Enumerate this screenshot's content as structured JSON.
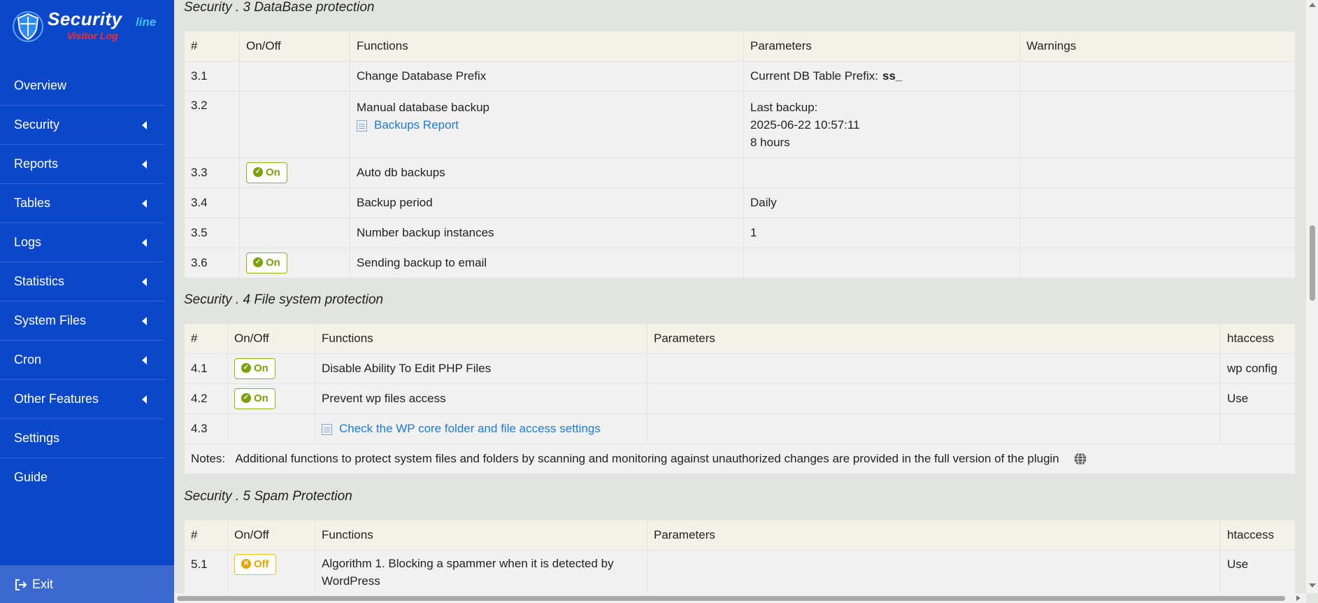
{
  "logo": {
    "title": "Security",
    "title_suffix": "line",
    "subtitle": "Visitor Log"
  },
  "sidebar": {
    "items": [
      {
        "label": "Overview",
        "has_arrow": false
      },
      {
        "label": "Security",
        "has_arrow": true
      },
      {
        "label": "Reports",
        "has_arrow": true
      },
      {
        "label": "Tables",
        "has_arrow": true
      },
      {
        "label": "Logs",
        "has_arrow": true
      },
      {
        "label": "Statistics",
        "has_arrow": true
      },
      {
        "label": "System Files",
        "has_arrow": true
      },
      {
        "label": "Cron",
        "has_arrow": true
      },
      {
        "label": "Other Features",
        "has_arrow": true
      },
      {
        "label": "Settings",
        "has_arrow": false
      },
      {
        "label": "Guide",
        "has_arrow": false
      }
    ],
    "exit_label": "Exit"
  },
  "sections": {
    "s3": {
      "title": "Security .  3  DataBase protection",
      "headers": [
        "#",
        "On/Off",
        "Functions",
        "Parameters",
        "Warnings"
      ],
      "rows": {
        "r1": {
          "num": "3.1",
          "function": "Change Database Prefix",
          "param_label": "Current DB Table Prefix:",
          "param_value": "ss_"
        },
        "r2": {
          "num": "3.2",
          "function": "Manual database backup",
          "link": "Backups Report",
          "param_line1": "Last backup:",
          "param_line2": "2025-06-22 10:57:11",
          "param_line3": "8 hours"
        },
        "r3": {
          "num": "3.3",
          "toggle": "On",
          "function": "Auto db backups"
        },
        "r4": {
          "num": "3.4",
          "function": "Backup period",
          "param": "Daily"
        },
        "r5": {
          "num": "3.5",
          "function": "Number backup instances",
          "param": "1"
        },
        "r6": {
          "num": "3.6",
          "toggle": "On",
          "function": "Sending backup to email"
        }
      }
    },
    "s4": {
      "title": "Security .  4  File system protection",
      "headers": [
        "#",
        "On/Off",
        "Functions",
        "Parameters",
        "htaccess"
      ],
      "rows": {
        "r1": {
          "num": "4.1",
          "toggle": "On",
          "function": "Disable Ability To Edit PHP Files",
          "htaccess": "wp config"
        },
        "r2": {
          "num": "4.2",
          "toggle": "On",
          "function": "Prevent wp files access",
          "htaccess": "Use"
        },
        "r3": {
          "num": "4.3",
          "link": "Check the WP core folder and file access settings"
        }
      },
      "notes_label": "Notes:",
      "notes_text": "Additional functions to protect system files and folders by scanning and monitoring against unauthorized changes are provided in the full version of the plugin"
    },
    "s5": {
      "title": "Security .  5  Spam Protection",
      "headers": [
        "#",
        "On/Off",
        "Functions",
        "Parameters",
        "htaccess"
      ],
      "rows": {
        "r1": {
          "num": "5.1",
          "toggle": "Off",
          "function_line1": "Algorithm 1.  Blocking a spammer when it is detected by",
          "function_line2": "WordPress",
          "htaccess": "Use"
        }
      }
    }
  },
  "colors": {
    "sidebar_bg": "#0d47c9",
    "exit_bg": "#3b69cf",
    "on_badge": "#7aa10a",
    "off_badge": "#e8a600",
    "link": "#1e7bd8"
  }
}
